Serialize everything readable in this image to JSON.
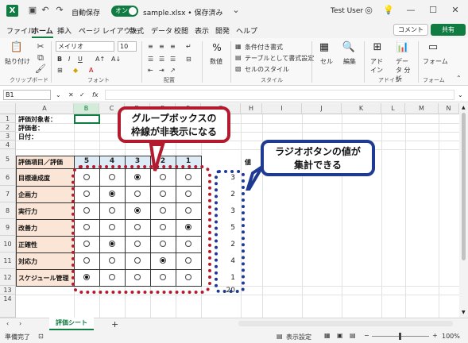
{
  "titlebar": {
    "autosave_label": "自動保存",
    "autosave_state": "オン",
    "doc_title": "sample.xlsx • 保存済み",
    "user_name": "Test User"
  },
  "menu": {
    "items": [
      "ファイル",
      "ホーム",
      "挿入",
      "ページ レイアウト",
      "数式",
      "データ",
      "校閲",
      "表示",
      "開発",
      "ヘルプ"
    ],
    "comment": "コメント",
    "share": "共有"
  },
  "ribbon": {
    "paste": "貼り付け",
    "font_name": "メイリオ",
    "font_size": "10",
    "number_label": "数値",
    "percent": "%",
    "cond_format": "条件付き書式",
    "table_format": "テーブルとして書式設定",
    "cell_style": "セルのスタイル",
    "cell": "セル",
    "edit": "編集",
    "addin": "アド イン",
    "data_analysis": "データ 分析",
    "form": "フォーム",
    "groups": {
      "clipboard": "クリップボード",
      "font": "フォント",
      "align": "配置",
      "style": "スタイル",
      "addin": "アドイン",
      "form": "フォーム"
    }
  },
  "formula_bar": {
    "name_box": "B1",
    "fx": "fx"
  },
  "columns": [
    "A",
    "B",
    "C",
    "D",
    "E",
    "F",
    "G",
    "H",
    "I",
    "J",
    "K",
    "L",
    "M",
    "N"
  ],
  "rows": [
    "1",
    "2",
    "3",
    "4",
    "5",
    "6",
    "7",
    "8",
    "9",
    "10",
    "11",
    "12",
    "13",
    "14"
  ],
  "sheet": {
    "evaluatee": "評価対象者：",
    "evaluator": "評価者：",
    "date": "日付：",
    "header_label": "評価項目／評価",
    "scores": [
      "5",
      "4",
      "3",
      "2",
      "1"
    ],
    "value_header": "値",
    "items": [
      {
        "label": "目標達成度",
        "selected": 3,
        "value": "3"
      },
      {
        "label": "企画力",
        "selected": 4,
        "value": "2"
      },
      {
        "label": "実行力",
        "selected": 3,
        "value": "3"
      },
      {
        "label": "改善力",
        "selected": 1,
        "value": "5"
      },
      {
        "label": "正確性",
        "selected": 4,
        "value": "2"
      },
      {
        "label": "対応力",
        "selected": 2,
        "value": "4"
      },
      {
        "label": "スケジュール管理",
        "selected": 5,
        "value": "1"
      }
    ],
    "total": "20"
  },
  "callouts": {
    "groupbox_line1": "グループボックスの",
    "groupbox_line2": "枠線が非表示になる",
    "radio_line1": "ラジオボタンの値が",
    "radio_line2": "集計できる"
  },
  "tabs": {
    "sheet_name": "評価シート",
    "add": "+"
  },
  "status": {
    "ready": "準備完了",
    "display_settings": "表示設定",
    "zoom": "100%"
  },
  "colors": {
    "accent": "#107c41",
    "callout_red": "#b31a2e",
    "callout_blue": "#1f3a93",
    "label_fill": "#fbe5d6",
    "header_fill": "#ddebf7"
  }
}
